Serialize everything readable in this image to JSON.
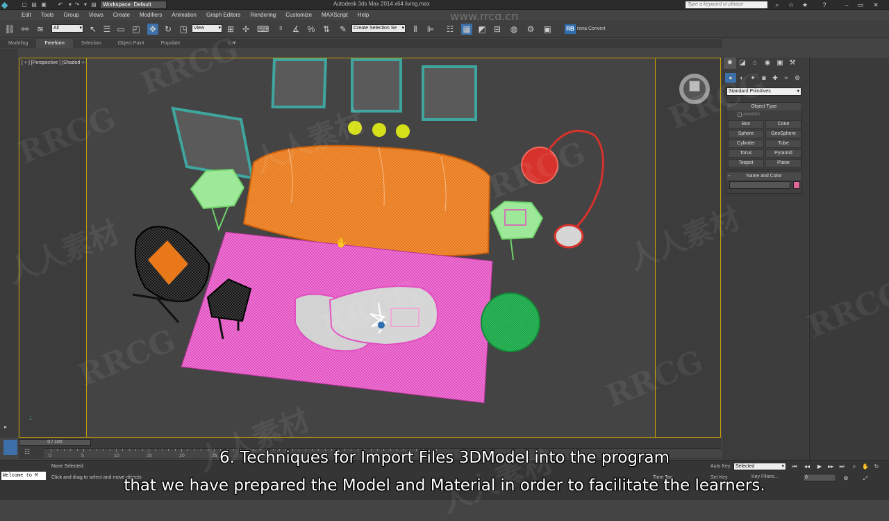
{
  "titlebar": {
    "workspace": "Workspace: Default",
    "window_title": "Autodesk 3ds Max 2014 x64     living.max",
    "search_placeholder": "Type a keyword or phrase",
    "site_watermark": "www.rrcg.cn"
  },
  "menu": [
    "Edit",
    "Tools",
    "Group",
    "Views",
    "Create",
    "Modifiers",
    "Animation",
    "Graph Editors",
    "Rendering",
    "Customize",
    "MAXScript",
    "Help"
  ],
  "toolbar": {
    "filter_value": "All",
    "view_value": "View",
    "selection_set_value": "Create Selection Se",
    "rb_label": "RB",
    "corona_label": "rona Convert"
  },
  "ribbon": {
    "tabs": [
      "Modeling",
      "Freeform",
      "Selection",
      "Object Paint",
      "Populate"
    ],
    "active_tab": "Freeform"
  },
  "viewport": {
    "label": "[ + ] [Perspective ] [Shaded + Edged Faces ]"
  },
  "command_panel": {
    "category": "Standard Primitives",
    "object_type_title": "Object Type",
    "autogrid_label": "AutoGrid",
    "buttons": [
      "Box",
      "Cone",
      "Sphere",
      "GeoSphere",
      "Cylinder",
      "Tube",
      "Torus",
      "Pyramid",
      "Teapot",
      "Plane"
    ],
    "name_color_title": "Name and Color",
    "swatch_color": "#e0669a"
  },
  "timeline": {
    "slider": "0 / 100",
    "ticks": [
      "0",
      "5",
      "10",
      "15",
      "20",
      "25"
    ]
  },
  "status": {
    "maxscript": "Welcome to M",
    "none_selected": "None Selected",
    "prompt": "Click and drag to select and move objects",
    "auto_key": "Auto Key",
    "set_key": "Set Key",
    "selected_value": "Selected",
    "key_filters": "Key Filters...",
    "frame": "0",
    "time_tag": "Time Tag"
  },
  "subtitles": {
    "line1": "6. Techniques for Import Files 3DModel into the program",
    "line2": "that we have prepared the Model and Material in order to facilitate the learners."
  },
  "watermarks": {
    "latin": "RRCG",
    "cn": "人人素材"
  },
  "colors": {
    "sofa": "#e8781a",
    "rug": "#e24fc0",
    "frame_teal": "#3fa59f",
    "lamp_red": "#d8322c",
    "pouf_green": "#1fa64a",
    "ball_yellow": "#d6e019",
    "side_table_green": "#8ef08c",
    "selection_border": "#c8a000"
  }
}
